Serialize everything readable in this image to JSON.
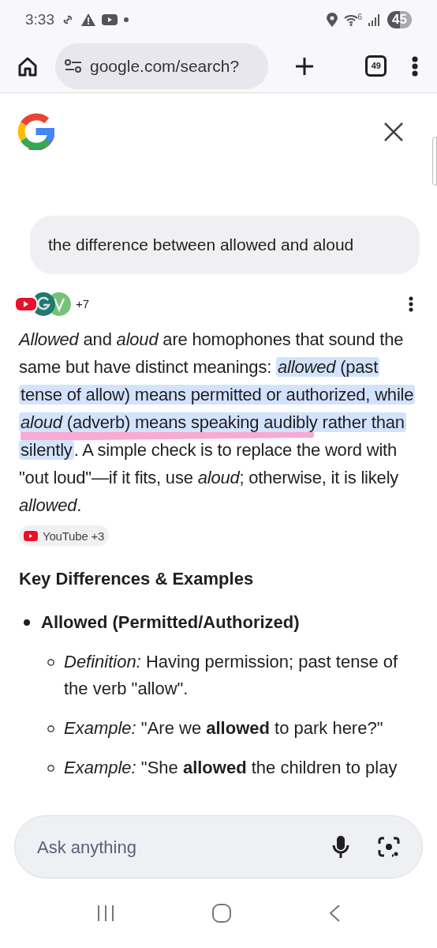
{
  "status_bar": {
    "time": "3:33",
    "wifi_label": "6",
    "battery": "45"
  },
  "browser": {
    "url": "google.com/search?",
    "tab_count": "49"
  },
  "query": "the difference between allowed and aloud",
  "sources": {
    "more": "+7"
  },
  "answer": [
    {
      "text": "*Allowed* and *aloud* are homophones that sound the same but have distinct meanings: ",
      "highlighted": false
    },
    {
      "text": "*allowed* (past tense of allow) means permitted or authorized, while *aloud* (adverb) means speaking audibly rather than silently",
      "highlighted": true
    },
    {
      "text": ". A simple check is to replace the word with \"out loud\"—if it fits, use *aloud*; otherwise, it is likely *allowed*.",
      "highlighted": false
    }
  ],
  "answer_source": "YouTube +3",
  "heading": "Key Differences & Examples",
  "bullets": [
    {
      "title": "Allowed (Permitted/Authorized)",
      "children": [
        {
          "text": "*Definition:* Having permission; past tense of the verb \"allow\"."
        },
        {
          "text": "*Example:* \"Are we **allowed** to park here?\""
        },
        {
          "text": "*Example:* \"She **allowed** the children to play"
        }
      ]
    }
  ],
  "ask": {
    "placeholder": "Ask anything"
  }
}
